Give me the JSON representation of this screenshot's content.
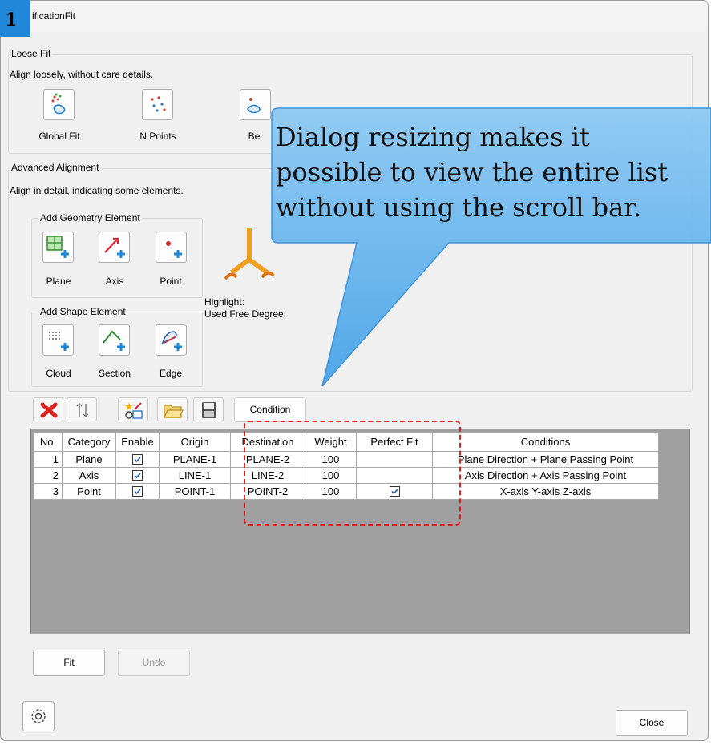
{
  "step_number": "1",
  "window": {
    "title": "ificationFit"
  },
  "loose_fit": {
    "title": "Loose Fit",
    "description": "Align loosely, without care details.",
    "buttons": [
      {
        "label": "Global Fit",
        "icon": "global-fit-icon"
      },
      {
        "label": "N Points",
        "icon": "n-points-icon"
      },
      {
        "label": "Be",
        "icon": "best-fit-icon"
      }
    ]
  },
  "advanced": {
    "title": "Advanced Alignment",
    "description": "Align in detail, indicating some elements.",
    "geometry_group": {
      "title": "Add Geometry Element",
      "buttons": [
        {
          "label": "Plane",
          "icon": "plane-icon"
        },
        {
          "label": "Axis",
          "icon": "axis-icon"
        },
        {
          "label": "Point",
          "icon": "point-icon"
        }
      ]
    },
    "shape_group": {
      "title": "Add Shape Element",
      "buttons": [
        {
          "label": "Cloud",
          "icon": "cloud-icon"
        },
        {
          "label": "Section",
          "icon": "section-icon"
        },
        {
          "label": "Edge",
          "icon": "edge-icon"
        }
      ]
    },
    "highlight_line1": "Highlight:",
    "highlight_line2": "Used Free Degree"
  },
  "toolbar": {
    "icons": [
      "delete-icon",
      "sort-icon",
      "new-icon",
      "open-folder-icon",
      "save-icon"
    ],
    "condition_label": "Condition"
  },
  "table": {
    "headers": [
      "No.",
      "Category",
      "Enable",
      "Origin",
      "Destination",
      "Weight",
      "Perfect Fit",
      "Conditions"
    ],
    "rows": [
      {
        "no": "1",
        "category": "Plane",
        "enable": true,
        "origin": "PLANE-1",
        "destination": "PLANE-2",
        "weight": "100",
        "perfect_fit": false,
        "conditions": "Plane Direction + Plane Passing Point"
      },
      {
        "no": "2",
        "category": "Axis",
        "enable": true,
        "origin": "LINE-1",
        "destination": "LINE-2",
        "weight": "100",
        "perfect_fit": false,
        "conditions": "Axis Direction + Axis Passing Point"
      },
      {
        "no": "3",
        "category": "Point",
        "enable": true,
        "origin": "POINT-1",
        "destination": "POINT-2",
        "weight": "100",
        "perfect_fit": true,
        "conditions": "X-axis Y-axis Z-axis"
      }
    ]
  },
  "buttons": {
    "fit": "Fit",
    "undo": "Undo",
    "close": "Close"
  },
  "callout": {
    "line1": "Dialog resizing makes it",
    "line2": "possible to view the entire list",
    "line3": "without using the scroll bar."
  },
  "colors": {
    "badge": "#1f88d8",
    "callout": "#5fb2ee",
    "highlight_dash": "#e02020"
  }
}
